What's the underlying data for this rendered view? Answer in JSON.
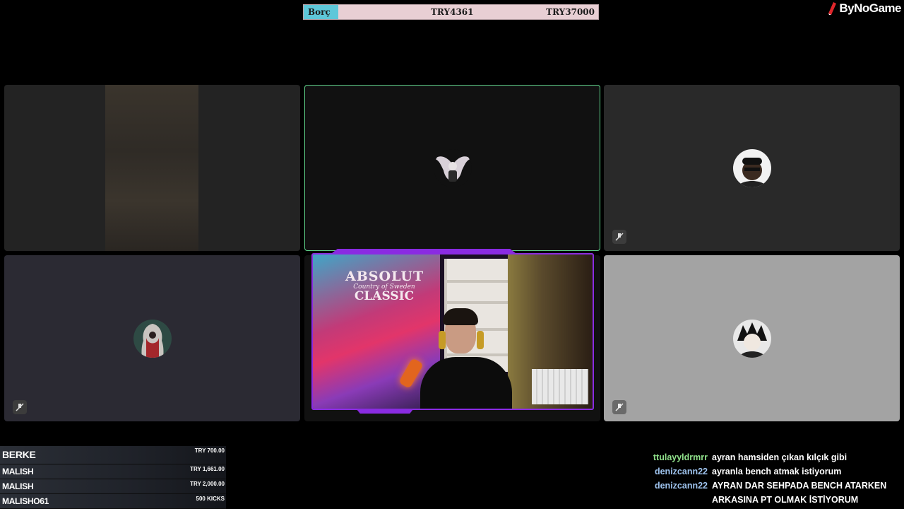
{
  "debt_bar": {
    "label": "Borç",
    "current": "TRY4361",
    "goal": "TRY37000",
    "progress_fraction": 0.12
  },
  "brand": {
    "name": "ByNoGame",
    "mark_color": "#e0262b"
  },
  "participants": {
    "accent_border": "#5fd38a",
    "streamer_frame_color": "#8a2be2"
  },
  "poster": {
    "line1": "ABSOLUT",
    "line2": "Country of Sweden",
    "line3": "CLASSIC"
  },
  "donations": [
    {
      "name": "BERKE",
      "amount": "TRY 700.00"
    },
    {
      "name": "MALISH",
      "amount": "TRY 1,661.00"
    },
    {
      "name": "MALISH",
      "amount": "TRY 2,000.00"
    },
    {
      "name": "MALISHO61",
      "amount": "500 KICKS"
    }
  ],
  "chat": [
    {
      "user": "ttulayyldrmrr",
      "color": "#8fe08a",
      "message": "ayran hamsiden çıkan kılçık gibi"
    },
    {
      "user": "denizcann22",
      "color": "#9fc4ef",
      "message": "ayranla bench atmak istiyorum"
    },
    {
      "user": "denizcann22",
      "color": "#9fc4ef",
      "message": "AYRAN DAR SEHPADA BENCH ATARKEN ARKASINA PT OLMAK İSTİYORUM"
    }
  ]
}
